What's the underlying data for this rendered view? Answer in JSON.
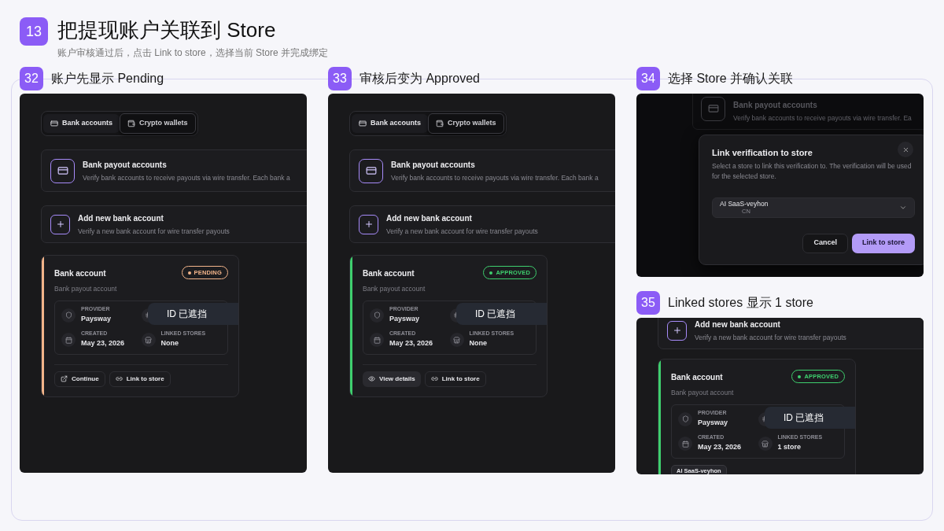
{
  "slide": {
    "number": "13",
    "title": "把提现账户关联到 Store",
    "subtitle": "账户审核通过后，点击 Link to store，选择当前 Store 并完成绑定"
  },
  "steps": [
    {
      "number": "32",
      "title": "账户先显示 Pending",
      "kind": "account",
      "tabs": [
        {
          "label": "Bank accounts",
          "selected": true
        },
        {
          "label": "Crypto wallets",
          "selected": false
        }
      ],
      "payout_card": {
        "title": "Bank payout accounts",
        "description": "Verify bank accounts to receive payouts via wire transfer. Each bank a"
      },
      "add_card": {
        "title": "Add new bank account",
        "description": "Verify a new bank account for wire transfer payouts"
      },
      "account": {
        "title": "Bank account",
        "subtitle": "Bank payout account",
        "status": {
          "label": "PENDING",
          "kind": "pending"
        },
        "fields": [
          {
            "label": "PROVIDER",
            "value": "Paysway"
          },
          {
            "label": "CREATED",
            "value": "May 23, 2026"
          },
          {
            "label": "LINKED STORES",
            "value": "None"
          }
        ],
        "redaction": "ID 已遮挡",
        "actions": [
          {
            "label": "Continue",
            "kind": "continue"
          },
          {
            "label": "Link to store",
            "kind": "link"
          }
        ]
      }
    },
    {
      "number": "33",
      "title": "审核后变为 Approved",
      "kind": "account",
      "tabs": [
        {
          "label": "Bank accounts",
          "selected": true
        },
        {
          "label": "Crypto wallets",
          "selected": false
        }
      ],
      "payout_card": {
        "title": "Bank payout accounts",
        "description": "Verify bank accounts to receive payouts via wire transfer. Each bank a"
      },
      "add_card": {
        "title": "Add new bank account",
        "description": "Verify a new bank account for wire transfer payouts"
      },
      "account": {
        "title": "Bank account",
        "subtitle": "Bank payout account",
        "status": {
          "label": "APPROVED",
          "kind": "approved"
        },
        "fields": [
          {
            "label": "PROVIDER",
            "value": "Paysway"
          },
          {
            "label": "CREATED",
            "value": "May 23, 2026"
          },
          {
            "label": "LINKED STORES",
            "value": "None"
          }
        ],
        "redaction": "ID 已遮挡",
        "actions": [
          {
            "label": "View details",
            "kind": "view"
          },
          {
            "label": "Link to store",
            "kind": "link"
          }
        ]
      }
    },
    {
      "number": "34",
      "title": "选择 Store 并确认关联",
      "kind": "dialog",
      "background": {
        "title": "Bank payout accounts",
        "description": "Verify bank accounts to receive payouts via wire transfer. Ea"
      },
      "dialog": {
        "title": "Link verification to store",
        "description": "Select a store to link this verification to. The verification will be used for the selected store.",
        "select": {
          "value": "AI SaaS-veyhon",
          "detail": "CN"
        },
        "buttons": [
          {
            "label": "Cancel",
            "kind": "secondary"
          },
          {
            "label": "Link to store",
            "kind": "primary"
          }
        ]
      }
    },
    {
      "number": "35",
      "title": "Linked stores 显示 1 store",
      "kind": "account",
      "add_card": {
        "title": "Add new bank account",
        "description": "Verify a new bank account for wire transfer payouts"
      },
      "account": {
        "title": "Bank account",
        "subtitle": "Bank payout account",
        "status": {
          "label": "APPROVED",
          "kind": "approved"
        },
        "fields": [
          {
            "label": "PROVIDER",
            "value": "Paysway"
          },
          {
            "label": "CREATED",
            "value": "May 23, 2026"
          },
          {
            "label": "LINKED STORES",
            "value": "1 store"
          }
        ],
        "redaction": "ID 已遮挡",
        "stores": [
          "AI SaaS-veyhon"
        ]
      }
    }
  ]
}
